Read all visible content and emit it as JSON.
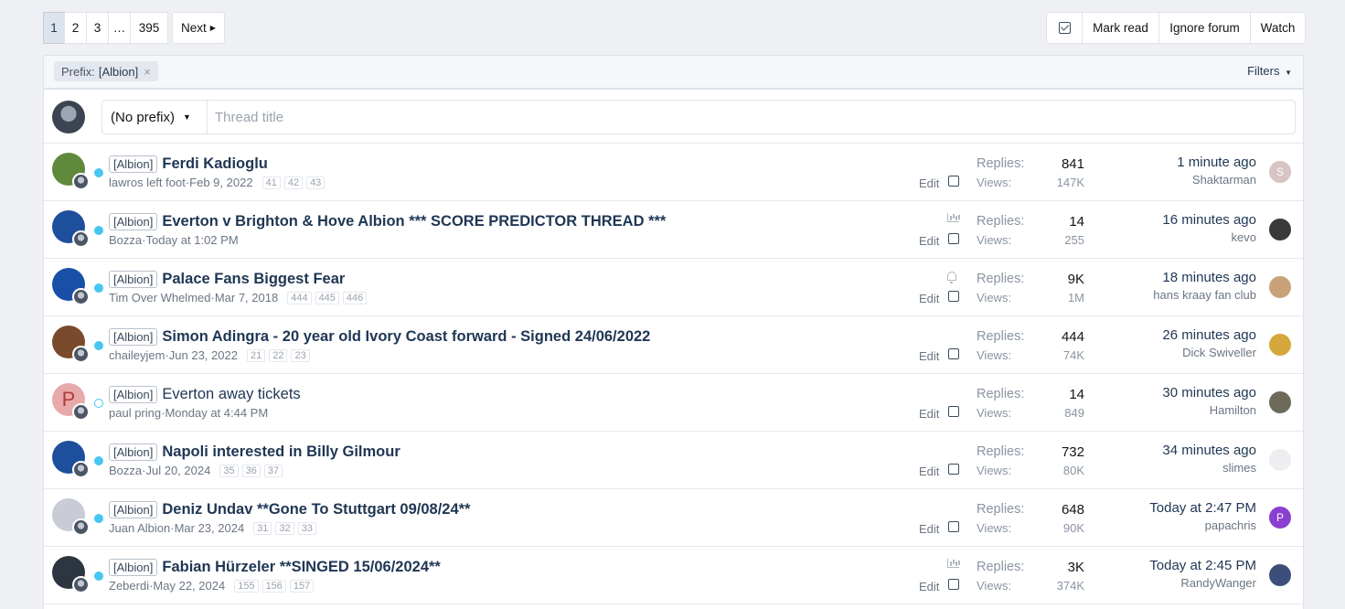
{
  "pagination": {
    "pages": [
      "1",
      "2",
      "3",
      "…",
      "395"
    ],
    "current": "1",
    "next_label": "Next"
  },
  "actions": {
    "mark_read": "Mark read",
    "ignore_forum": "Ignore forum",
    "watch": "Watch"
  },
  "filter_bar": {
    "prefix_label": "Prefix:",
    "prefix_value": "[Albion]",
    "remove_glyph": "×",
    "filters_label": "Filters"
  },
  "new_thread": {
    "prefix_select": "(No prefix)",
    "title_placeholder": "Thread title"
  },
  "threads": [
    {
      "prefix": "[Albion]",
      "title": "Ferdi Kadioglu",
      "unread": true,
      "author": "lawros left foot",
      "date": "Feb 9, 2022",
      "pages": [
        "41",
        "42",
        "43"
      ],
      "status_icon": "",
      "replies": "841",
      "views": "147K",
      "last_time": "1 minute ago",
      "last_user": "Shaktarman",
      "avatar_color": "#5f8a3c",
      "last_avatar_color": "#d8c4c4",
      "last_avatar_letter": "S"
    },
    {
      "prefix": "[Albion]",
      "title": "Everton v Brighton & Hove Albion *** SCORE PREDICTOR THREAD ***",
      "unread": true,
      "author": "Bozza",
      "date": "Today at 1:02 PM",
      "pages": [],
      "status_icon": "poll-icon",
      "replies": "14",
      "views": "255",
      "last_time": "16 minutes ago",
      "last_user": "kevo",
      "avatar_color": "#1d4f9c",
      "last_avatar_color": "#3a3a3a",
      "last_avatar_letter": ""
    },
    {
      "prefix": "[Albion]",
      "title": "Palace Fans Biggest Fear",
      "unread": true,
      "author": "Tim Over Whelmed",
      "date": "Mar 7, 2018",
      "pages": [
        "444",
        "445",
        "446"
      ],
      "status_icon": "bell-icon",
      "replies": "9K",
      "views": "1M",
      "last_time": "18 minutes ago",
      "last_user": "hans kraay fan club",
      "avatar_color": "#1a4fa8",
      "last_avatar_color": "#c9a27a",
      "last_avatar_letter": ""
    },
    {
      "prefix": "[Albion]",
      "title": "Simon Adingra - 20 year old Ivory Coast forward - Signed 24/06/2022",
      "unread": true,
      "author": "chaileyjem",
      "date": "Jun 23, 2022",
      "pages": [
        "21",
        "22",
        "23"
      ],
      "status_icon": "",
      "replies": "444",
      "views": "74K",
      "last_time": "26 minutes ago",
      "last_user": "Dick Swiveller",
      "avatar_color": "#7a4a2c",
      "last_avatar_color": "#d4a83c",
      "last_avatar_letter": ""
    },
    {
      "prefix": "[Albion]",
      "title": "Everton away tickets",
      "unread": false,
      "author": "paul pring",
      "date": "Monday at 4:44 PM",
      "pages": [],
      "status_icon": "",
      "replies": "14",
      "views": "849",
      "last_time": "30 minutes ago",
      "last_user": "Hamilton",
      "avatar_color": "#e7a9a9",
      "avatar_letter": "P",
      "last_avatar_color": "#6e6a5a",
      "last_avatar_letter": ""
    },
    {
      "prefix": "[Albion]",
      "title": "Napoli interested in Billy Gilmour",
      "unread": true,
      "author": "Bozza",
      "date": "Jul 20, 2024",
      "pages": [
        "35",
        "36",
        "37"
      ],
      "status_icon": "",
      "replies": "732",
      "views": "80K",
      "last_time": "34 minutes ago",
      "last_user": "slimes",
      "avatar_color": "#1d4f9c",
      "last_avatar_color": "#eceef1",
      "last_avatar_letter": ""
    },
    {
      "prefix": "[Albion]",
      "title": "Deniz Undav **Gone To Stuttgart 09/08/24**",
      "unread": true,
      "author": "Juan Albion",
      "date": "Mar 23, 2024",
      "pages": [
        "31",
        "32",
        "33"
      ],
      "status_icon": "",
      "replies": "648",
      "views": "90K",
      "last_time": "Today at 2:47 PM",
      "last_user": "papachris",
      "avatar_color": "#c9ccd6",
      "last_avatar_color": "#8b3fd0",
      "last_avatar_letter": "P"
    },
    {
      "prefix": "[Albion]",
      "title": "Fabian Hürzeler **SINGED 15/06/2024**",
      "unread": true,
      "author": "Zeberdi",
      "date": "May 22, 2024",
      "pages": [
        "155",
        "156",
        "157"
      ],
      "status_icon": "poll-icon",
      "replies": "3K",
      "views": "374K",
      "last_time": "Today at 2:45 PM",
      "last_user": "RandyWanger",
      "avatar_color": "#2d3540",
      "last_avatar_color": "#3c4f7a",
      "last_avatar_letter": ""
    }
  ],
  "labels": {
    "replies": "Replies:",
    "views": "Views:",
    "edit": "Edit",
    "separator": " · "
  }
}
